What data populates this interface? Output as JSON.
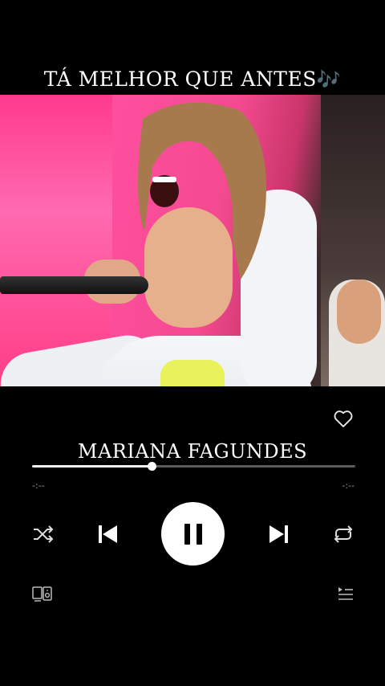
{
  "overlay": {
    "title": "TÁ MELHOR QUE ANTES",
    "title_emoji": "🎶"
  },
  "player": {
    "artist": "MARIANA FAGUNDES",
    "elapsed": "-:--",
    "remaining": "-:--",
    "progress": 0.37,
    "state": "playing"
  },
  "icons": {
    "like": "heart-outline-icon",
    "shuffle": "shuffle-icon",
    "previous": "skip-previous-icon",
    "pause": "pause-icon",
    "next": "skip-next-icon",
    "repeat": "repeat-icon",
    "devices": "connect-device-icon",
    "queue": "queue-icon"
  },
  "colors": {
    "background": "#000000",
    "accent": "#ffffff",
    "track": "#5a5a5a",
    "note_emoji": "#9b59ff"
  }
}
